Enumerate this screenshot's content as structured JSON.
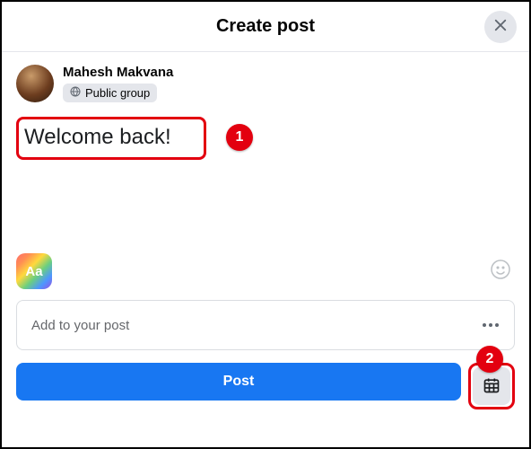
{
  "header": {
    "title": "Create post"
  },
  "user": {
    "name": "Mahesh Makvana",
    "audience": "Public group"
  },
  "compose": {
    "text": "Welcome back!"
  },
  "aa_button": {
    "label": "Aa"
  },
  "addto": {
    "label": "Add to your post"
  },
  "actions": {
    "post_label": "Post"
  },
  "callouts": {
    "one": "1",
    "two": "2"
  }
}
